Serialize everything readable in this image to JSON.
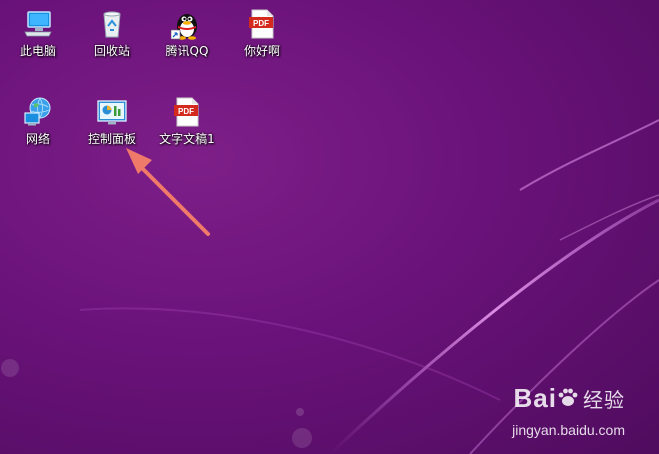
{
  "desktop": {
    "icons": [
      {
        "label": "此电脑",
        "icon": "computer-icon"
      },
      {
        "label": "回收站",
        "icon": "recycle-bin-icon"
      },
      {
        "label": "腾讯QQ",
        "icon": "qq-penguin-icon"
      },
      {
        "label": "你好啊",
        "icon": "pdf-file-icon"
      },
      {
        "label": "网络",
        "icon": "network-globe-icon"
      },
      {
        "label": "控制面板",
        "icon": "control-panel-icon"
      },
      {
        "label": "文字文稿1",
        "icon": "pdf-file-icon"
      }
    ],
    "pdf_badge": "PDF"
  },
  "watermark": {
    "brand": "Bai",
    "brand_cn": "经验",
    "url": "jingyan.baidu.com"
  },
  "colors": {
    "background": "#6a127a",
    "arrow": "#f07a6a"
  }
}
